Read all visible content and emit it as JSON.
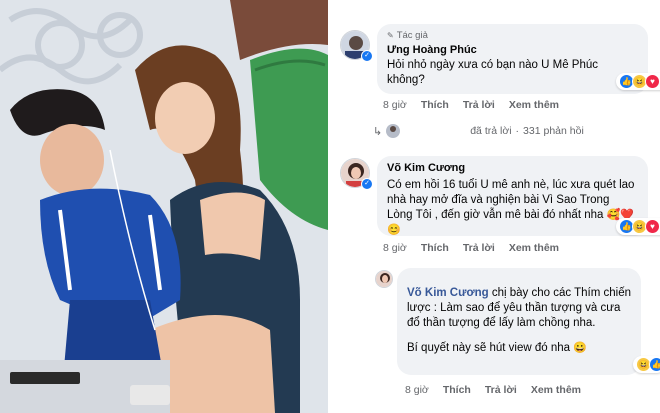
{
  "comment1": {
    "badge": "Tác giả",
    "author": "Ưng Hoàng Phúc",
    "text": "Hỏi nhỏ ngày xưa có bạn nào U Mê Phúc không?",
    "time": "8 giờ",
    "like": "Thích",
    "reply": "Trả lời",
    "more": "Xem thêm",
    "reaction_count": "5"
  },
  "replies_bar": {
    "label": "đã trả lời",
    "separator": "·",
    "count": "331 phản hồi"
  },
  "comment2": {
    "author": "Võ Kim Cương",
    "text": "Có em hồi 16 tuổi U mê anh nè, lúc xưa quét lao nhà hay mở đĩa và nghiện bài Vì Sao Trong Lòng Tôi , đến giờ vẫn mê bài đó nhất nha",
    "time": "8 giờ",
    "like": "Thích",
    "reply": "Trả lời",
    "more": "Xem thêm",
    "reaction_count": "5"
  },
  "comment3": {
    "author": "Võ Kim Cương",
    "text": "chị bày cho các Thím chiến lược : Làm sao để yêu thần tượng và cưa đổ thần tượng để lấy làm chồng nha.",
    "text2": "Bí quyết này sẽ hút view đó nha",
    "time": "8 giờ",
    "like": "Thích",
    "reply": "Trả lời",
    "more": "Xem thêm"
  },
  "colors": {
    "link": "#385898",
    "bubble": "#f0f2f5",
    "muted": "#65676b",
    "verified": "#1877f2"
  },
  "icons": [
    "pen-icon",
    "verified-icon",
    "like-icon",
    "haha-icon",
    "love-icon",
    "reply-arrow-icon",
    "smile-emoji-icon",
    "heart-emoji-icon"
  ]
}
